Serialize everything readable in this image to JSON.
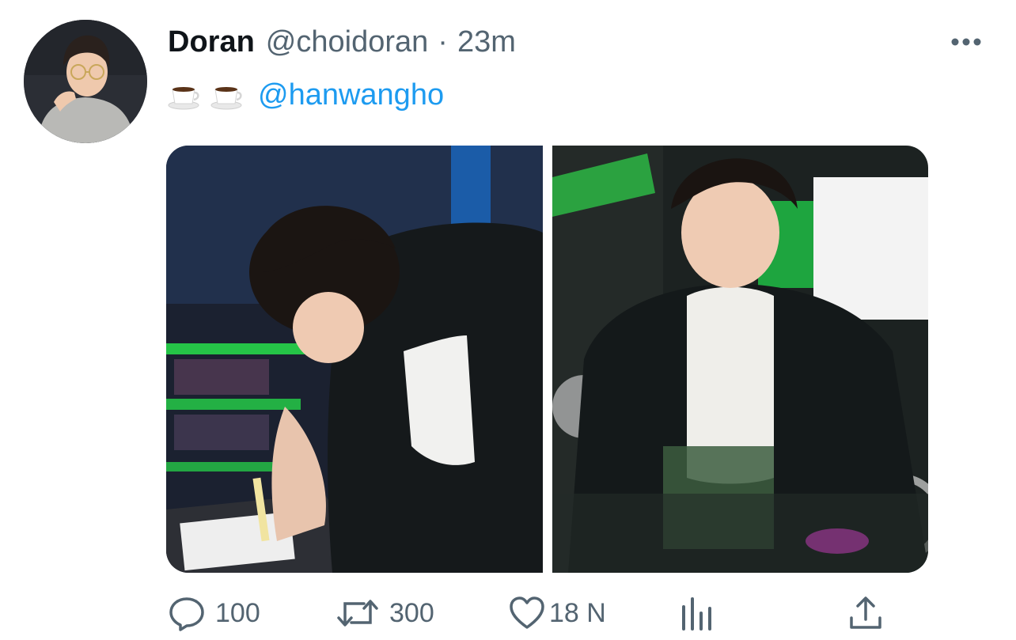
{
  "tweet": {
    "display_name": "Doran",
    "handle": "@choidoran",
    "separator": "·",
    "time": "23m",
    "emojis": [
      "coffee-emoji",
      "coffee-emoji"
    ],
    "mention": "@hanwangho"
  },
  "actions": {
    "reply_count": "100",
    "retweet_count": "300",
    "like_count": "18 N"
  },
  "colors": {
    "text_primary": "#0f1419",
    "text_secondary": "#536471",
    "link": "#1d9bf0",
    "accent_green": "#22e34a"
  },
  "icons": {
    "more": "more-horizontal-icon",
    "reply": "reply-icon",
    "retweet": "retweet-icon",
    "like": "heart-icon",
    "views": "analytics-bar-icon",
    "share": "share-upload-icon"
  }
}
